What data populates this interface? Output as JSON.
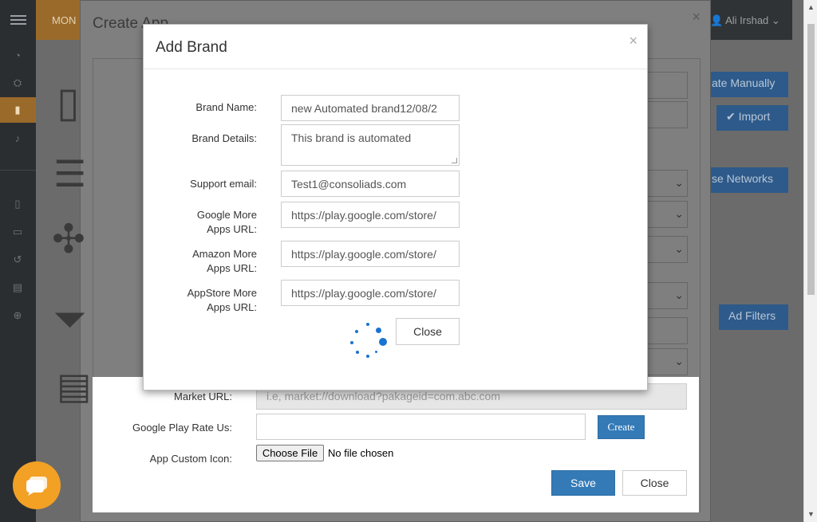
{
  "topbar": {
    "brand_text": "MON",
    "user_name": "Ali Irshad"
  },
  "background_buttons": {
    "create_manually": "ate Manually",
    "import": "Import",
    "use_networks": "se Networks",
    "ad_filters": "Ad Filters"
  },
  "create_app_modal": {
    "title": "Create App",
    "market_url_label": "Market URL:",
    "market_url_placeholder": "i.e, market://download?pakageid=com.abc.com",
    "rate_us_label": "Google Play Rate Us:",
    "create_button": "Create",
    "custom_icon_label": "App Custom Icon:",
    "choose_file_button": "Choose File",
    "no_file_text": "No file chosen",
    "save_button": "Save",
    "close_button": "Close"
  },
  "add_brand_modal": {
    "title": "Add Brand",
    "fields": {
      "brand_name_label": "Brand Name:",
      "brand_name_value": "new Automated brand12/08/2",
      "brand_details_label": "Brand Details:",
      "brand_details_value": "This brand is automated",
      "support_email_label": "Support email:",
      "support_email_value": "Test1@consoliads.com",
      "google_label_line1": "Google More",
      "google_label_line2": "Apps URL:",
      "google_value": "https://play.google.com/store/",
      "amazon_label_line1": "Amazon More",
      "amazon_label_line2": "Apps URL:",
      "amazon_value": "https://play.google.com/store/",
      "appstore_label_line1": "AppStore More",
      "appstore_label_line2": "Apps URL:",
      "appstore_value": "https://play.google.com/store/"
    },
    "close_button": "Close"
  },
  "icons": {
    "close": "×",
    "chevron_down": "chevron-down-icon",
    "chat": "chat-icon",
    "spinner": "loading-spinner"
  },
  "colors": {
    "primary": "#337ab7",
    "accent_orange": "#f2a125",
    "spinner": "#1a73d0"
  }
}
